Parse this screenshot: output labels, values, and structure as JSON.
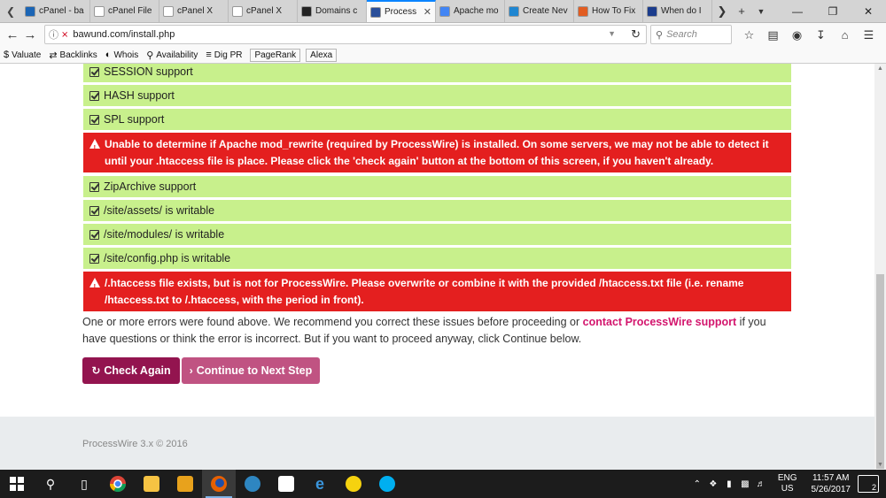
{
  "tabs": [
    {
      "label": "cPanel - ba",
      "color": "#1b65b5",
      "active": false
    },
    {
      "label": "cPanel File Man",
      "color": "#ffffff",
      "active": false
    },
    {
      "label": "cPanel X",
      "color": "#ffffff",
      "active": false
    },
    {
      "label": "cPanel X",
      "color": "#ffffff",
      "active": false
    },
    {
      "label": "Domains c",
      "color": "#222222",
      "active": false
    },
    {
      "label": "Process",
      "color": "#2a4f9a",
      "active": true
    },
    {
      "label": "Apache mo",
      "color": "#4285f4",
      "active": false
    },
    {
      "label": "Create Nev",
      "color": "#1f86d1",
      "active": false
    },
    {
      "label": "How To Fix",
      "color": "#e25d22",
      "active": false
    },
    {
      "label": "When do I",
      "color": "#1b3c8c",
      "active": false
    }
  ],
  "tab_logo_texts": {
    "domains": "LBS",
    "howto": "YS"
  },
  "nav": {
    "url": "bawund.com/install.php",
    "search_placeholder": "Search"
  },
  "bookmarks": [
    {
      "label": "Valuate",
      "icon": "dollar-icon"
    },
    {
      "label": "Backlinks",
      "icon": "link-icon"
    },
    {
      "label": "Whois",
      "icon": "globe-icon"
    },
    {
      "label": "Availability",
      "icon": "magnifier-icon"
    },
    {
      "label": "Dig PR",
      "icon": "rank-icon"
    }
  ],
  "bookmark_boxes": [
    "PageRank",
    "Alexa"
  ],
  "checks": [
    {
      "type": "ok",
      "text": "SESSION support"
    },
    {
      "type": "ok",
      "text": "HASH support"
    },
    {
      "type": "ok",
      "text": "SPL support"
    },
    {
      "type": "error",
      "text": "Unable to determine if Apache mod_rewrite (required by ProcessWire) is installed. On some servers, we may not be able to detect it until your .htaccess file is place. Please click the 'check again' button at the bottom of this screen, if you haven't already."
    },
    {
      "type": "ok",
      "text": "ZipArchive support"
    },
    {
      "type": "ok",
      "text": "/site/assets/ is writable"
    },
    {
      "type": "ok",
      "text": "/site/modules/ is writable"
    },
    {
      "type": "ok",
      "text": "/site/config.php is writable"
    },
    {
      "type": "error",
      "text": "/.htaccess file exists, but is not for ProcessWire. Please overwrite or combine it with the provided /htaccess.txt file (i.e. rename /htaccess.txt to /.htaccess, with the period in front)."
    }
  ],
  "notice": {
    "before": "One or more errors were found above. We recommend you correct these issues before proceeding or ",
    "link": "contact ProcessWire support",
    "after": " if you have questions or think the error is incorrect. But if you want to proceed anyway, click Continue below."
  },
  "buttons": {
    "check_again": "Check Again",
    "continue": "Continue to Next Step"
  },
  "footer": {
    "text": "ProcessWire 3.x © 2016"
  },
  "taskbar": {
    "lang_top": "ENG",
    "lang_bottom": "US",
    "time": "11:57 AM",
    "date": "5/26/2017",
    "notifications": "2"
  }
}
